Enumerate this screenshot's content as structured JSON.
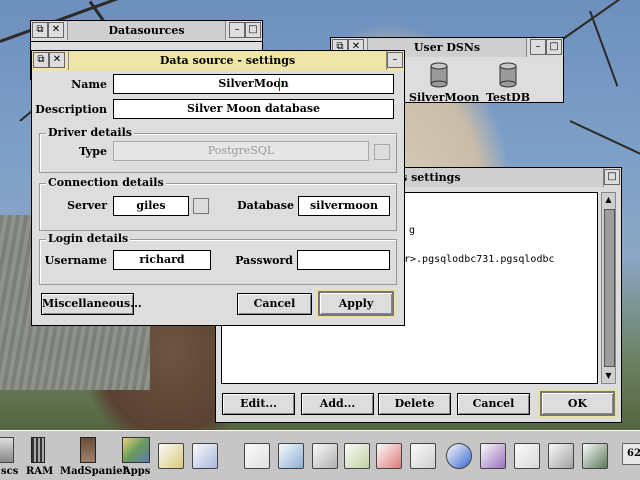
{
  "datasources_window": {
    "title": "Datasources"
  },
  "user_dsns_window": {
    "title": "User DSNs",
    "items": [
      {
        "label": "SilverMoon",
        "icon": "database-icon"
      },
      {
        "label": "TestDB",
        "icon": "database-icon"
      }
    ]
  },
  "misc_window": {
    "title": "laneous settings",
    "text_lines": [
      "g",
      "r>.pgsqlodbc731.pgsqlodbc"
    ],
    "buttons": {
      "edit": "Edit...",
      "add": "Add...",
      "delete": "Delete",
      "cancel": "Cancel",
      "ok": "OK"
    }
  },
  "settings_window": {
    "title": "Data source - settings",
    "name_label": "Name",
    "name_value": "SilverMoon",
    "description_label": "Description",
    "description_value": "Silver Moon database",
    "driver_group": "Driver details",
    "type_label": "Type",
    "type_value": "PostgreSQL",
    "connection_group": "Connection details",
    "server_label": "Server",
    "server_value": "giles",
    "database_label": "Database",
    "database_value": "silvermoon",
    "login_group": "Login details",
    "username_label": "Username",
    "username_value": "richard",
    "password_label": "Password",
    "password_value": "",
    "misc_button": "Miscellaneous...",
    "cancel_button": "Cancel",
    "apply_button": "Apply"
  },
  "iconbar": {
    "left_items": [
      {
        "label": "scs",
        "icon": "disc-icon"
      },
      {
        "label": "RAM",
        "icon": "ram-disc-icon"
      },
      {
        "label": "MadSpaniel",
        "icon": "madspaniel-icon"
      },
      {
        "label": "Apps",
        "icon": "apps-icon"
      }
    ],
    "right_icons": [
      "app-icon",
      "graph-icon",
      "help-icon",
      "tools-icon",
      "chips-icon",
      "magnifier-icon",
      "paint-icon",
      "web-icon",
      "globe-icon",
      "stamp-icon",
      "edit-icon",
      "printer-icon",
      "display-icon"
    ],
    "clock": "62"
  }
}
